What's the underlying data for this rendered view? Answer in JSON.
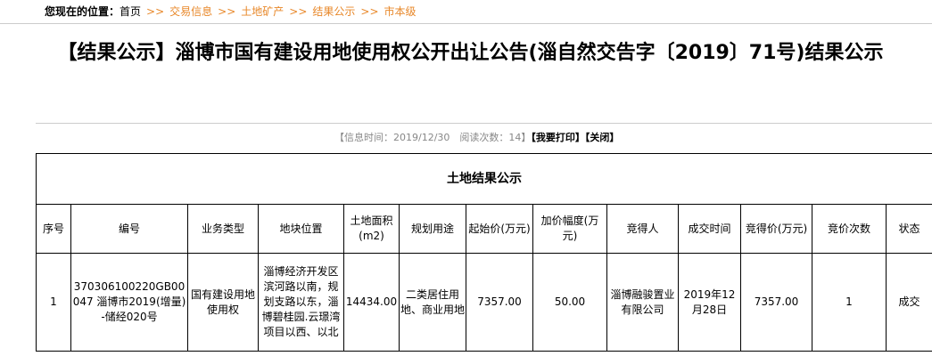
{
  "breadcrumb": {
    "label": "您现在的位置：",
    "home": "首页",
    "items": [
      "交易信息",
      "土地矿产",
      "结果公示",
      "市本级"
    ],
    "sep": ">>"
  },
  "title": "【结果公示】淄博市国有建设用地使用权公开出让公告(淄自然交告字〔2019〕71号)结果公示",
  "meta": {
    "info": "【信息时间：2019/12/30　阅读次数：14】",
    "print": "【我要打印】",
    "close": "【关闭】"
  },
  "table": {
    "caption": "土地结果公示",
    "headers": [
      "序号",
      "编号",
      "业务类型",
      "地块位置",
      "土地面积(m2)",
      "规划用途",
      "起始价(万元)",
      "加价幅度(万元)",
      "竞得人",
      "成交时间",
      "竞得价(万元)",
      "竞价次数",
      "状态"
    ],
    "rows": [
      [
        "1",
        "370306100220GB00047 淄博市2019(增量)-储经020号",
        "国有建设用地使用权",
        "淄博经济开发区滨河路以南，规划支路以东，淄博碧桂园.云璟湾项目以西、以北",
        "14434.00",
        "二类居住用地、商业用地",
        "7357.00",
        "50.00",
        "淄博融骏置业有限公司",
        "2019年12月28日",
        "7357.00",
        "1",
        "成交"
      ]
    ]
  }
}
